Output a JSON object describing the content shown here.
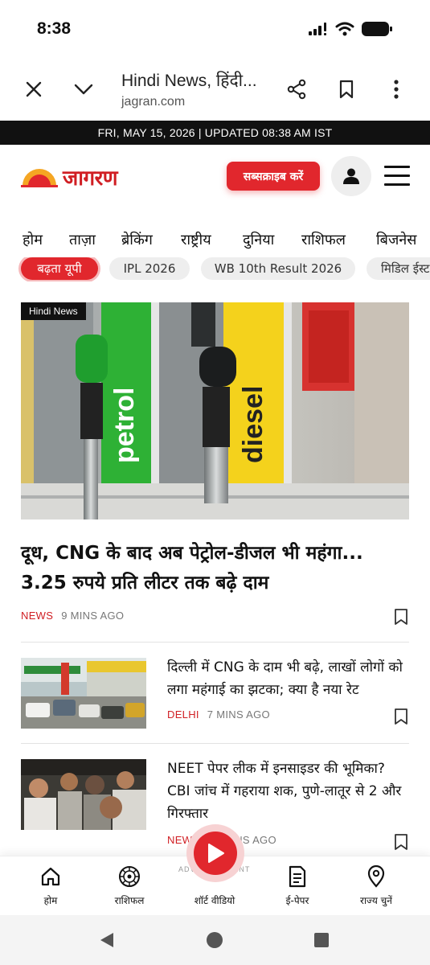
{
  "status_bar": {
    "time": "8:38"
  },
  "browser": {
    "page_title": "Hindi News, हिंदी...",
    "domain": "jagran.com"
  },
  "date_bar": {
    "text": "FRI, MAY 15, 2026 | UPDATED 08:38 AM IST"
  },
  "header": {
    "logo_text": "जागरण",
    "subscribe_label": "सब्सक्राइब करें"
  },
  "nav": {
    "items": [
      "होम",
      "ताज़ा",
      "ब्रेकिंग",
      "राष्ट्रीय",
      "दुनिया",
      "राशिफल",
      "बिजनेस"
    ]
  },
  "chips": [
    "बढ़ता यूपी",
    "IPL 2026",
    "WB 10th Result 2026",
    "मिडिल ईस्ट"
  ],
  "hero": {
    "tag": "Hindi News",
    "image_labels": [
      "petrol",
      "diesel"
    ],
    "title": "दूध, CNG के बाद अब पेट्रोल-डीजल भी महंगा... 3.25 रुपये प्रति लीटर तक बढ़े दाम",
    "category": "NEWS",
    "time": "9 MINS AGO"
  },
  "articles": [
    {
      "title": "दिल्ली में CNG के दाम भी बढ़े, लाखों लोगों को लगा महंगाई का झटका; क्या है नया रेट",
      "category": "DELHI",
      "time": "7 MINS AGO"
    },
    {
      "title": "NEET पेपर लीक में इनसाइडर की भूमिका? CBI जांच में गहराया शक, पुणे-लातूर से 2 और गिरफ्तार",
      "category": "NEWS",
      "time": "15 MINS AGO"
    }
  ],
  "ad_label": "ADVERTISEMENT",
  "bottom_nav": {
    "items": [
      "होम",
      "राशिफल",
      "शॉर्ट वीडियो",
      "ई-पेपर",
      "राज्य चुनें"
    ]
  },
  "colors": {
    "brand_red": "#e1272d",
    "dark": "#111111",
    "muted": "#777777"
  }
}
